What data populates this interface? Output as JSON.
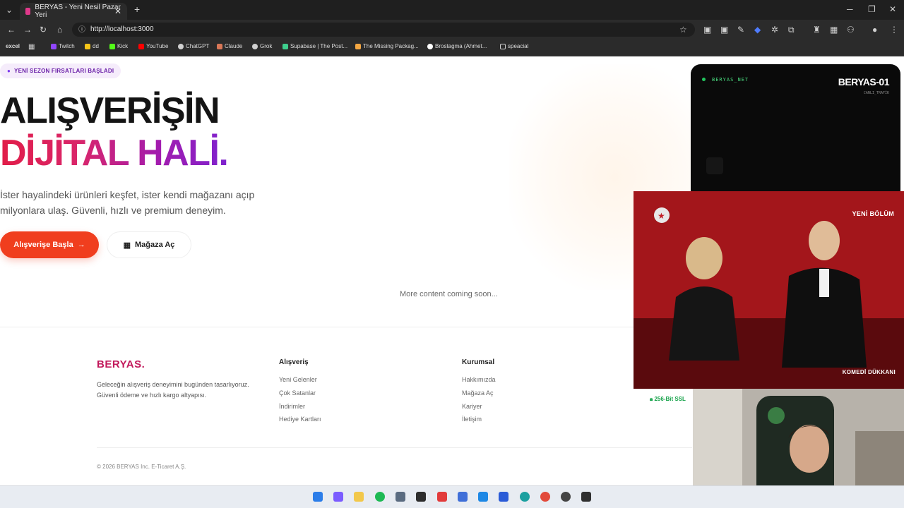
{
  "browser": {
    "tab_title": "BERYAS - Yeni Nesil Pazar Yeri",
    "url": "http://localhost:3000",
    "bookmarks": [
      {
        "label": "excel",
        "color": "#e5e5e5"
      },
      {
        "label": "Twitch",
        "color": "#9146ff"
      },
      {
        "label": "dd",
        "color": "#f5c518"
      },
      {
        "label": "Kick",
        "color": "#53fc18"
      },
      {
        "label": "YouTube",
        "color": "#ff0000"
      },
      {
        "label": "ChatGPT",
        "color": "#d0d0d0"
      },
      {
        "label": "Claude",
        "color": "#d97757"
      },
      {
        "label": "Grok",
        "color": "#d0d0d0"
      },
      {
        "label": "Supabase | The Post...",
        "color": "#3ecf8e"
      },
      {
        "label": "The Missing Packag...",
        "color": "#f4a742"
      },
      {
        "label": "Brostagma (Ahmet...",
        "color": "#ffffff"
      },
      {
        "label": "speacial",
        "color": "#cfcfcf"
      }
    ]
  },
  "hero": {
    "badge": "YENİ SEZON FIRSATLARI BAŞLADI",
    "title_line1": "ALIŞVERİŞİN",
    "title_line2": "DİJİTAL HALİ",
    "title_dot": ".",
    "description": "İster hayalindeki ürünleri keşfet, ister kendi mağazanı açıp milyonlara ulaş. Güvenli, hızlı ve premium deneyim.",
    "primary_button": "Alışverişe Başla",
    "secondary_button": "Mağaza Aç",
    "coming_soon": "More content coming soon..."
  },
  "footer": {
    "logo": "BERYAS.",
    "description": "Geleceğin alışveriş deneyimini bugünden tasarlıyoruz. Güvenli ödeme ve hızlı kargo altyapısı.",
    "col1_title": "Alışveriş",
    "col1_links": [
      "Yeni Gelenler",
      "Çok Satanlar",
      "İndirimler",
      "Hediye Kartları"
    ],
    "col2_title": "Kurumsal",
    "col2_links": [
      "Hakkımızda",
      "Mağaza Aç",
      "Kariyer",
      "İletişim"
    ],
    "ssl": "256-Bit SSL",
    "copyright": "© 2026 BERYAS Inc. E-Ticaret A.Ş."
  },
  "overlay_net": {
    "label": "BERYAS_NET",
    "title": "BERYAS-01",
    "subtitle": "CANLI_TRAFİK"
  },
  "overlay_tv": {
    "badge": "YENİ BÖLÜM",
    "show": "KOMEDİ DÜKKANI"
  }
}
